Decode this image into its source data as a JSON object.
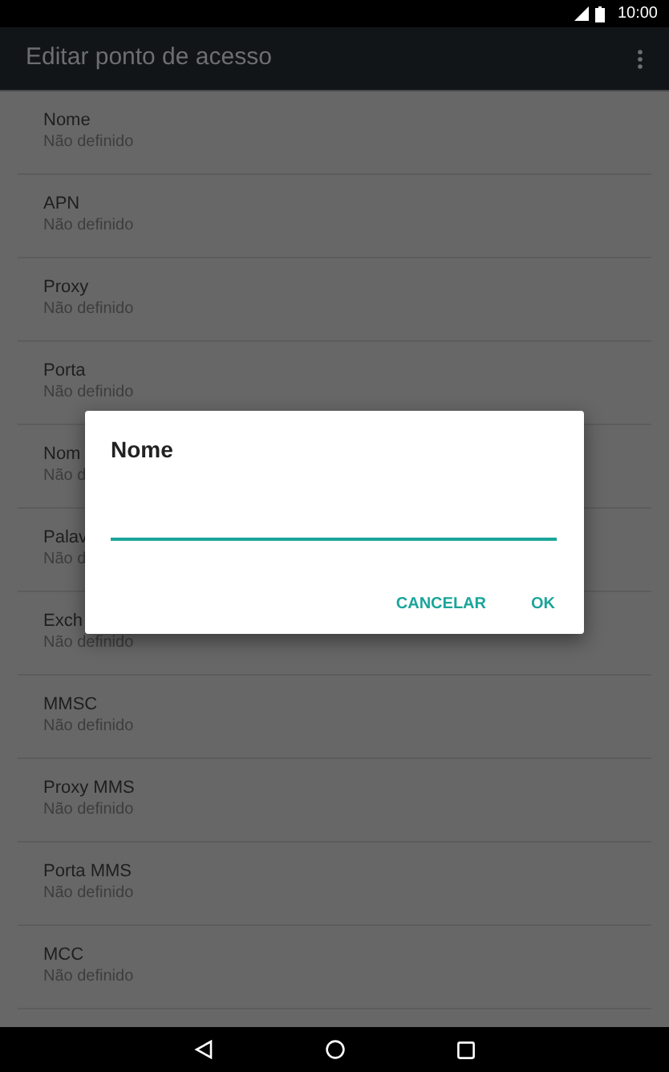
{
  "status_bar": {
    "time": "10:00"
  },
  "app_bar": {
    "title": "Editar ponto de acesso"
  },
  "settings": [
    {
      "title": "Nome",
      "summary": "Não definido"
    },
    {
      "title": "APN",
      "summary": "Não definido"
    },
    {
      "title": "Proxy",
      "summary": "Não definido"
    },
    {
      "title": "Porta",
      "summary": "Não definido"
    },
    {
      "title": "Nom",
      "summary": "Não d"
    },
    {
      "title": "Palav",
      "summary": "Não d"
    },
    {
      "title": "Exch",
      "summary": "Não definido"
    },
    {
      "title": "MMSC",
      "summary": "Não definido"
    },
    {
      "title": "Proxy MMS",
      "summary": "Não definido"
    },
    {
      "title": "Porta MMS",
      "summary": "Não definido"
    },
    {
      "title": "MCC",
      "summary": "Não definido"
    }
  ],
  "dialog": {
    "title": "Nome",
    "buttons": [
      "CANCELAR",
      "OK"
    ]
  }
}
